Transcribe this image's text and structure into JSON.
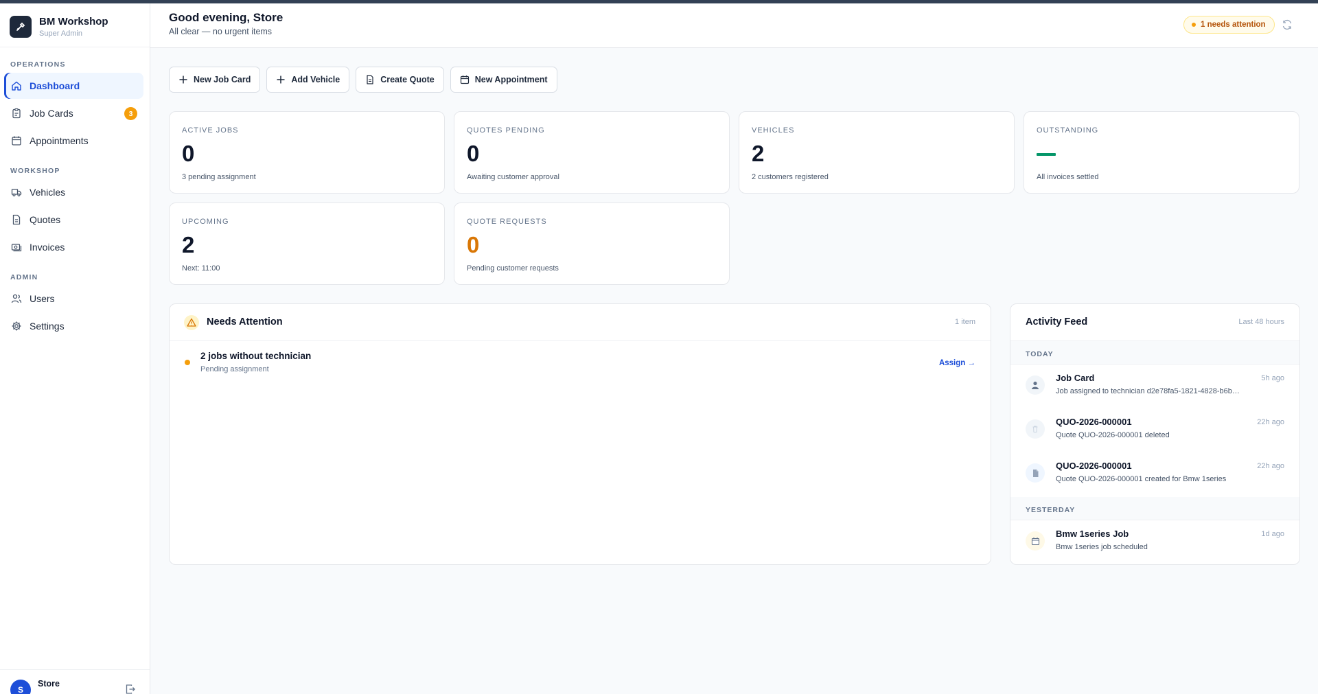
{
  "brand": {
    "name": "BM Workshop",
    "role": "Super Admin"
  },
  "sidebar": {
    "sections": [
      {
        "label": "OPERATIONS",
        "items": [
          {
            "label": "Dashboard",
            "icon": "home-icon",
            "active": true
          },
          {
            "label": "Job Cards",
            "icon": "clipboard-icon",
            "badge": "3"
          },
          {
            "label": "Appointments",
            "icon": "calendar-icon"
          }
        ]
      },
      {
        "label": "WORKSHOP",
        "items": [
          {
            "label": "Vehicles",
            "icon": "truck-icon"
          },
          {
            "label": "Quotes",
            "icon": "document-icon"
          },
          {
            "label": "Invoices",
            "icon": "cash-icon"
          }
        ]
      },
      {
        "label": "ADMIN",
        "items": [
          {
            "label": "Users",
            "icon": "users-icon"
          },
          {
            "label": "Settings",
            "icon": "gear-icon"
          }
        ]
      }
    ],
    "user": {
      "initial": "S",
      "name": "Store"
    }
  },
  "header": {
    "greeting": "Good evening, Store",
    "subtitle": "All clear — no urgent items",
    "attention_pill": "1 needs attention"
  },
  "actions": [
    {
      "label": "New Job Card",
      "icon": "plus-icon"
    },
    {
      "label": "Add Vehicle",
      "icon": "plus-icon"
    },
    {
      "label": "Create Quote",
      "icon": "document-icon"
    },
    {
      "label": "New Appointment",
      "icon": "calendar-icon"
    }
  ],
  "stats": [
    {
      "label": "ACTIVE JOBS",
      "value": "0",
      "sub": "3 pending assignment"
    },
    {
      "label": "QUOTES PENDING",
      "value": "0",
      "sub": "Awaiting customer approval"
    },
    {
      "label": "VEHICLES",
      "value": "2",
      "sub": "2 customers registered"
    },
    {
      "label": "OUTSTANDING",
      "value": "",
      "sub": "All invoices settled",
      "display": "dash"
    },
    {
      "label": "UPCOMING",
      "value": "2",
      "sub": "Next: 11:00"
    },
    {
      "label": "QUOTE REQUESTS",
      "value": "0",
      "sub": "Pending customer requests",
      "accent": "#d97706"
    }
  ],
  "needs_attention": {
    "title": "Needs Attention",
    "count": "1 item",
    "items": [
      {
        "title": "2 jobs without technician",
        "sub": "Pending assignment",
        "action": "Assign →"
      }
    ]
  },
  "activity_feed": {
    "title": "Activity Feed",
    "range": "Last 48 hours",
    "groups": [
      {
        "label": "TODAY",
        "items": [
          {
            "title": "Job Card",
            "desc": "Job assigned to technician d2e78fa5-1821-4828-b6b…",
            "time": "5h ago",
            "icon": "user-icon"
          },
          {
            "title": "QUO-2026-000001",
            "desc": "Quote QUO-2026-000001 deleted",
            "time": "22h ago",
            "icon": "trash-icon"
          },
          {
            "title": "QUO-2026-000001",
            "desc": "Quote QUO-2026-000001 created for Bmw 1series",
            "time": "22h ago",
            "icon": "file-icon"
          }
        ]
      },
      {
        "label": "YESTERDAY",
        "items": [
          {
            "title": "Bmw 1series Job",
            "desc": "Bmw 1series job scheduled",
            "time": "1d ago",
            "icon": "calendar-icon"
          }
        ]
      }
    ]
  },
  "colors": {
    "accent": "#1d4ed8",
    "warning": "#f59e0b",
    "success": "#059669",
    "sidebar_logo": "#1e293b"
  }
}
